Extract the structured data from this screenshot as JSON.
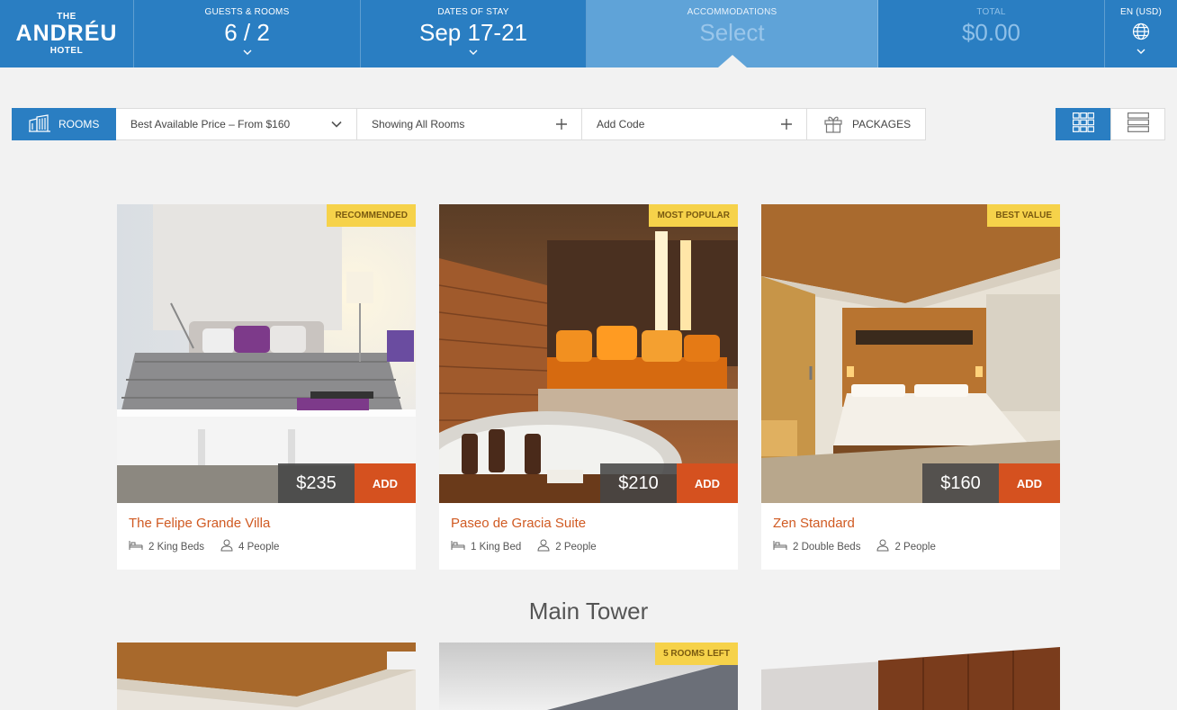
{
  "brand": {
    "top": "THE",
    "name": "ANDRÉU",
    "bottom": "HOTEL"
  },
  "header": {
    "guests": {
      "label": "GUESTS & ROOMS",
      "value": "6 / 2"
    },
    "dates": {
      "label": "DATES OF STAY",
      "value": "Sep 17-21"
    },
    "accommodations": {
      "label": "ACCOMMODATIONS",
      "value": "Select"
    },
    "total": {
      "label": "TOTAL",
      "value": "$0.00"
    },
    "language": {
      "label": "EN (USD)"
    }
  },
  "filters": {
    "rooms_label": "ROOMS",
    "price": "Best Available Price – From $160",
    "showing": "Showing All Rooms",
    "code": "Add Code",
    "packages": "PACKAGES"
  },
  "rooms": [
    {
      "badge": "RECOMMENDED",
      "price": "$235",
      "add": "ADD",
      "name": "The Felipe Grande Villa",
      "beds": "2 King Beds",
      "people": "4 People"
    },
    {
      "badge": "MOST POPULAR",
      "price": "$210",
      "add": "ADD",
      "name": "Paseo de Gracia Suite",
      "beds": "1 King Bed",
      "people": "2 People"
    },
    {
      "badge": "BEST VALUE",
      "price": "$160",
      "add": "ADD",
      "name": "Zen Standard",
      "beds": "2 Double Beds",
      "people": "2 People"
    }
  ],
  "section": {
    "title": "Main Tower"
  },
  "tower_rooms": [
    {
      "badge": ""
    },
    {
      "badge": "5 ROOMS LEFT"
    },
    {
      "badge": ""
    }
  ],
  "colors": {
    "primary": "#2a7ec2",
    "accent": "#d5511f",
    "badge": "#f6d24a"
  }
}
